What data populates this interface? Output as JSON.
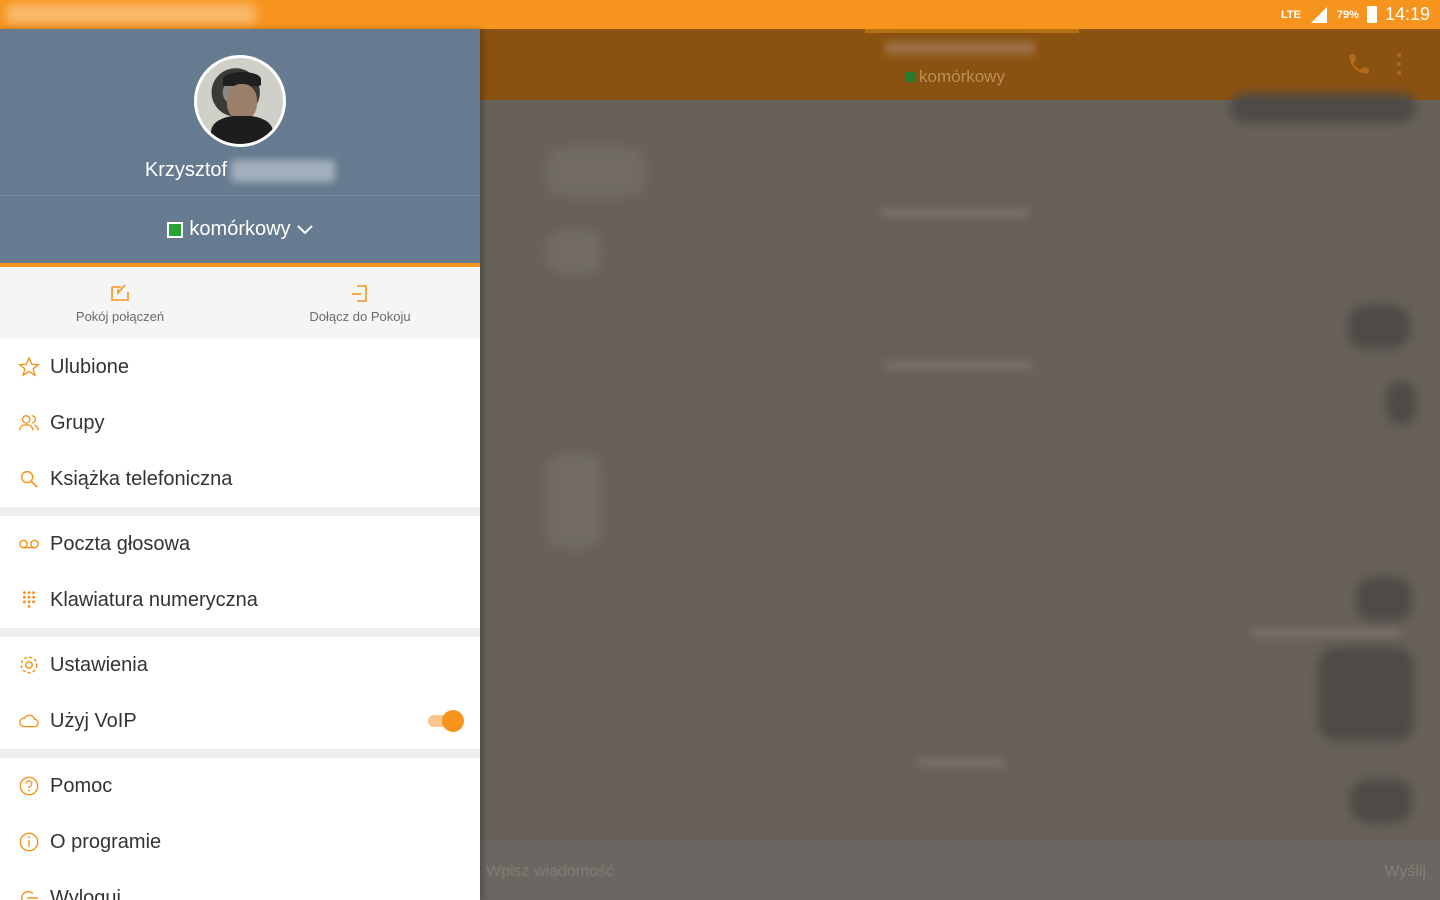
{
  "status_bar": {
    "network": "LTE",
    "battery": "79%",
    "time": "14:19"
  },
  "drawer": {
    "profile": {
      "first_name": "Krzysztof"
    },
    "presence": {
      "label": "komórkowy"
    },
    "quick_actions": [
      {
        "label": "Pokój połączeń",
        "icon": "incoming-call-room-icon"
      },
      {
        "label": "Dołącz do Pokoju",
        "icon": "join-room-icon"
      }
    ],
    "menu_groups": [
      [
        {
          "label": "Ulubione",
          "icon": "star-icon"
        },
        {
          "label": "Grupy",
          "icon": "group-icon"
        },
        {
          "label": "Książka telefoniczna",
          "icon": "search-icon"
        }
      ],
      [
        {
          "label": "Poczta głosowa",
          "icon": "voicemail-icon"
        },
        {
          "label": "Klawiatura numeryczna",
          "icon": "dialpad-icon"
        }
      ],
      [
        {
          "label": "Ustawienia",
          "icon": "gear-icon"
        },
        {
          "label": "Użyj VoIP",
          "icon": "cloud-icon",
          "toggle": true
        }
      ],
      [
        {
          "label": "Pomoc",
          "icon": "help-icon"
        },
        {
          "label": "O programie",
          "icon": "info-icon"
        },
        {
          "label": "Wyloguj",
          "icon": "logout-icon"
        }
      ]
    ]
  },
  "chat": {
    "header_status": "komórkowy",
    "input_placeholder": "Wpisz wiadomość",
    "send_label": "Wyślij"
  },
  "colors": {
    "accent": "#f7941d",
    "profile_bg": "#667b8f",
    "presence_green": "#2aa235"
  }
}
